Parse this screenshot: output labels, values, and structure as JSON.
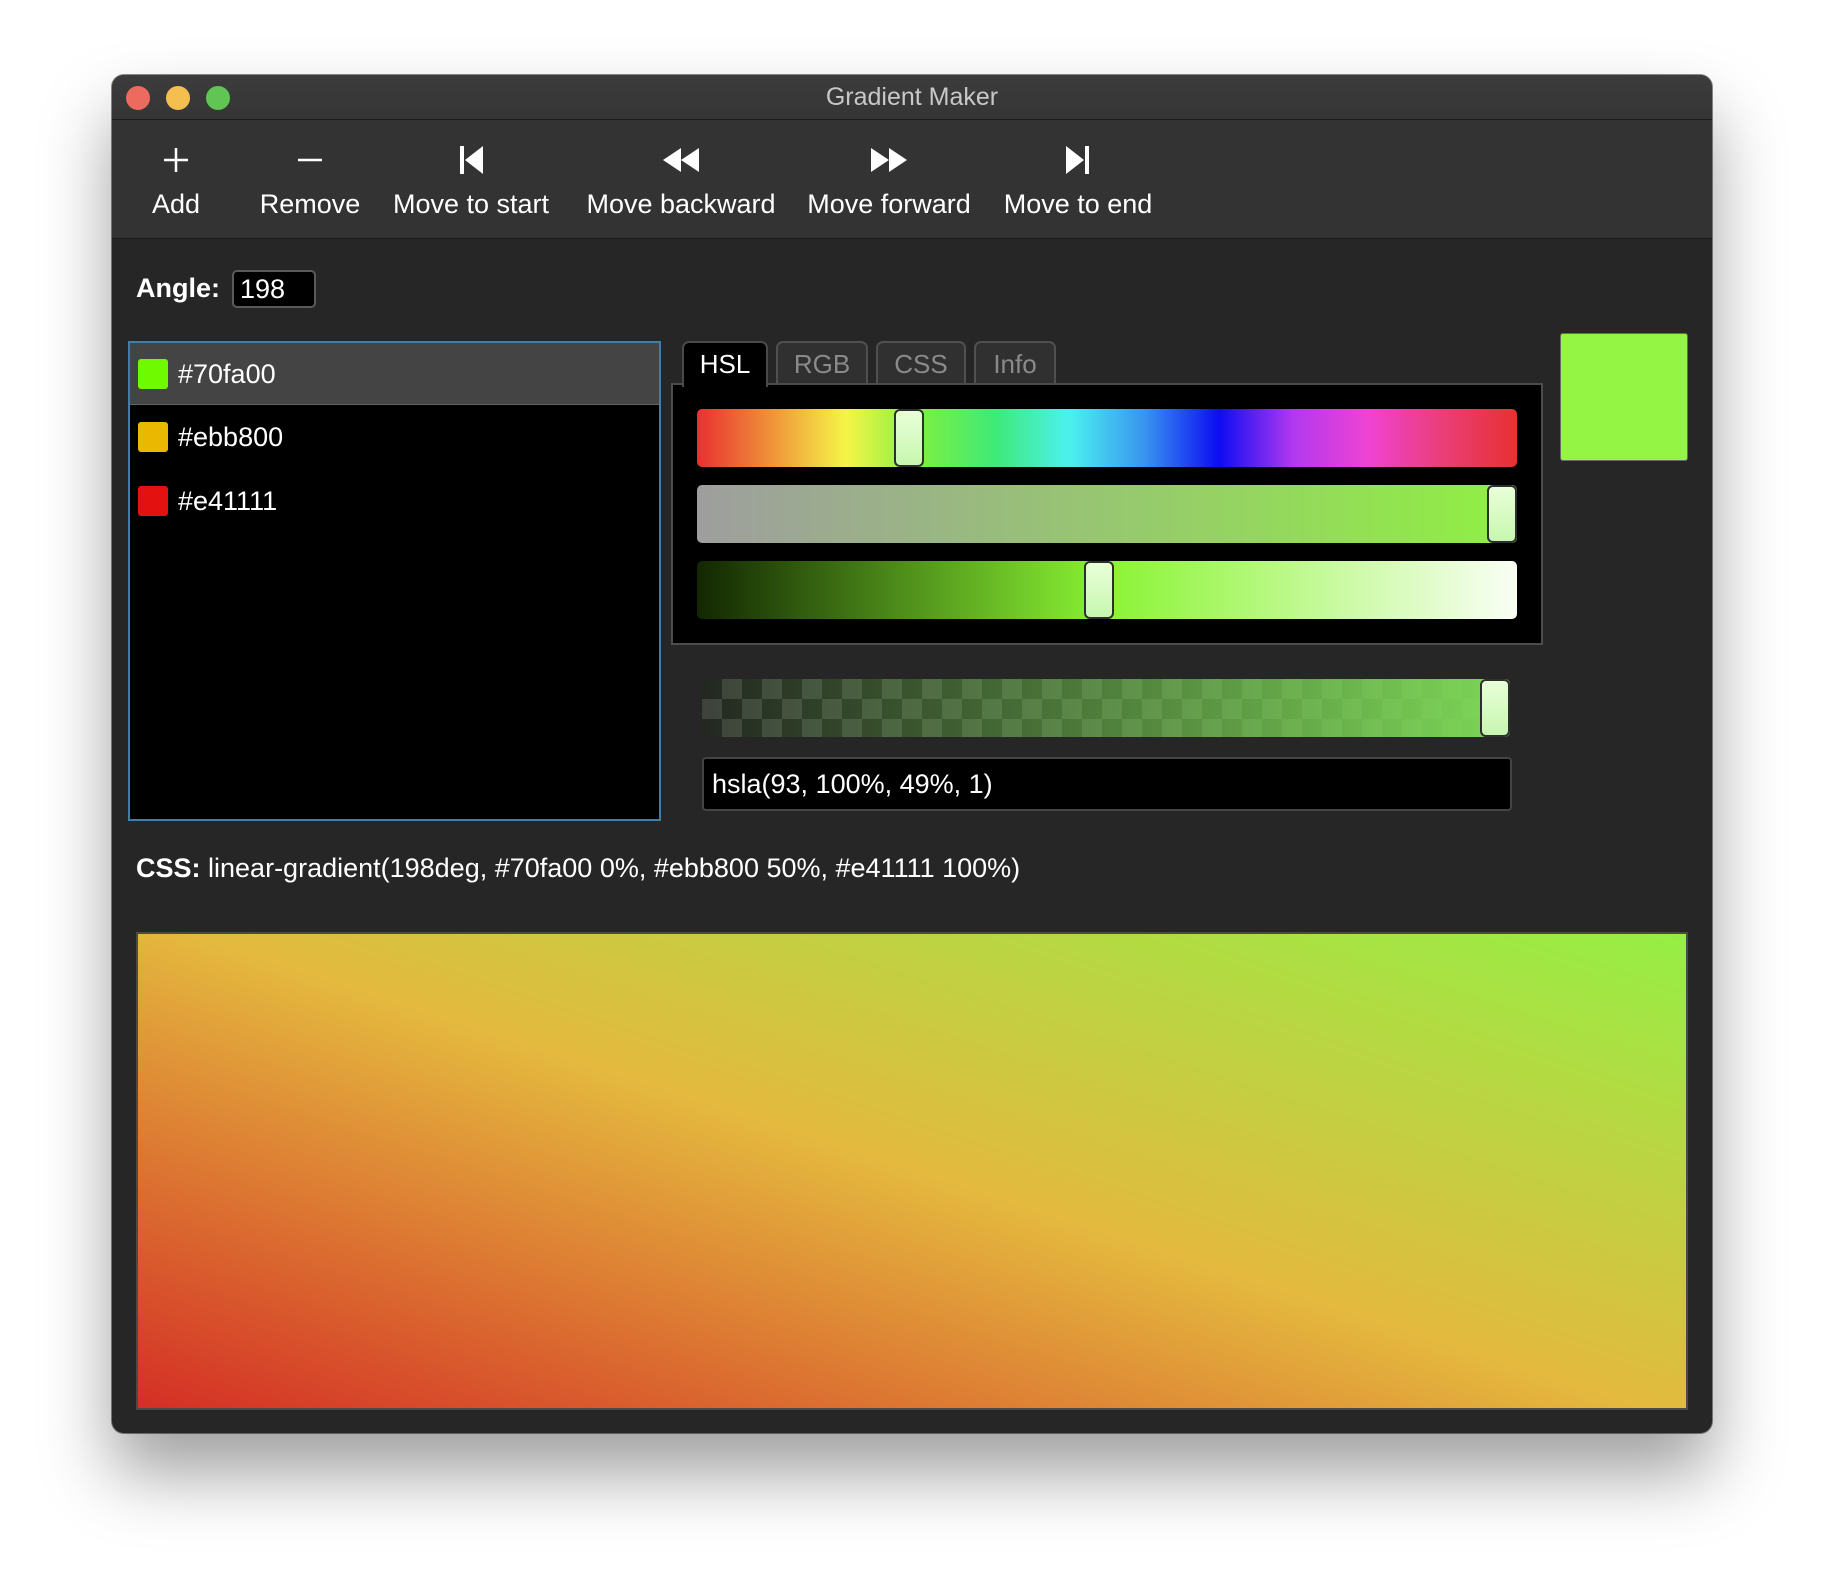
{
  "window": {
    "title": "Gradient Maker",
    "traffic_lights": {
      "close": "#ed6a5e",
      "minimize": "#f4bf4f",
      "zoom": "#61c554"
    }
  },
  "toolbar": {
    "items": [
      {
        "label": "Add",
        "icon": "plus-icon"
      },
      {
        "label": "Remove",
        "icon": "minus-icon"
      },
      {
        "label": "Move to start",
        "icon": "skip-to-start-icon"
      },
      {
        "label": "Move backward",
        "icon": "rewind-icon"
      },
      {
        "label": "Move forward",
        "icon": "fast-forward-icon"
      },
      {
        "label": "Move to end",
        "icon": "skip-to-end-icon"
      }
    ]
  },
  "angle": {
    "label": "Angle:",
    "value": "198"
  },
  "stops": [
    {
      "label": "#70fa00",
      "color": "#70fa00",
      "selected": true
    },
    {
      "label": "#ebb800",
      "color": "#ebb800",
      "selected": false
    },
    {
      "label": "#e41111",
      "color": "#e41111",
      "selected": false
    }
  ],
  "tabs": [
    {
      "label": "HSL",
      "active": true
    },
    {
      "label": "RGB",
      "active": false
    },
    {
      "label": "CSS",
      "active": false
    },
    {
      "label": "Info",
      "active": false
    }
  ],
  "hsl": {
    "hue": 93,
    "saturation": 100,
    "lightness": 49,
    "alpha": 1
  },
  "color_preview": "#95f545",
  "color_text": "hsla(93, 100%, 49%, 1)",
  "css": {
    "label": "CSS:",
    "value": "linear-gradient(198deg, #70fa00 0%, #ebb800 50%, #e41111 100%)"
  },
  "gradient_colors": {
    "start": "#95ef45",
    "middle": "#e4b93e",
    "end": "#d42f25"
  }
}
